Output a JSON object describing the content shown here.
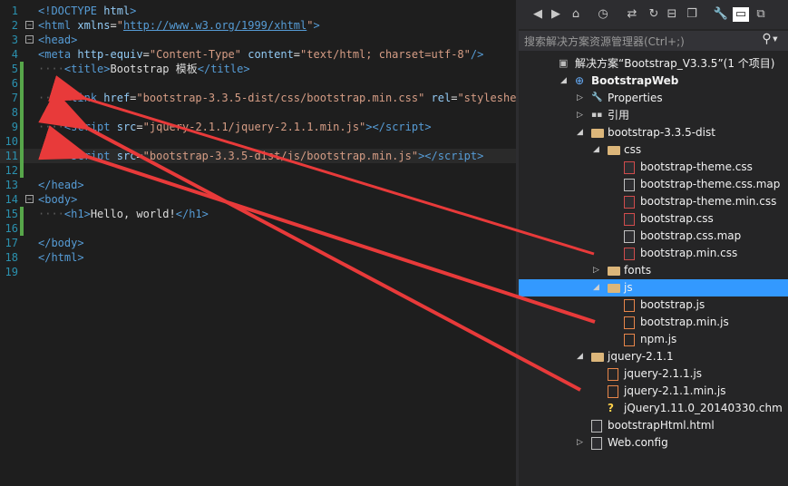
{
  "editor": {
    "lines": [
      {
        "n": "1",
        "html": [
          [
            "d",
            ""
          ],
          [
            "t",
            "<!DOCTYPE "
          ],
          [
            "a",
            "html"
          ],
          [
            "t",
            ">"
          ]
        ]
      },
      {
        "n": "2",
        "html": [
          [
            "t",
            "<"
          ],
          [
            "t",
            "html "
          ],
          [
            "a",
            "xmlns"
          ],
          [
            "x",
            "="
          ],
          [
            "s",
            "\""
          ],
          [
            "u",
            "http://www.w3.org/1999/xhtml"
          ],
          [
            "s",
            "\""
          ],
          [
            "t",
            ">"
          ]
        ]
      },
      {
        "n": "3",
        "html": [
          [
            "t",
            "<"
          ],
          [
            "t",
            "head"
          ],
          [
            "t",
            ">"
          ]
        ]
      },
      {
        "n": "4",
        "html": [
          [
            "t",
            "<"
          ],
          [
            "t",
            "meta "
          ],
          [
            "a",
            "http-equiv"
          ],
          [
            "x",
            "="
          ],
          [
            "s",
            "\"Content-Type\" "
          ],
          [
            "a",
            "content"
          ],
          [
            "x",
            "="
          ],
          [
            "s",
            "\"text/html; charset=utf-8\""
          ],
          [
            "t",
            "/>"
          ]
        ]
      },
      {
        "n": "5",
        "html": [
          [
            "d",
            "····"
          ],
          [
            "t",
            "<"
          ],
          [
            "t",
            "title"
          ],
          [
            "t",
            ">"
          ],
          [
            "x",
            "Bootstrap 模板"
          ],
          [
            "t",
            "</"
          ],
          [
            "t",
            "title"
          ],
          [
            "t",
            ">"
          ]
        ]
      },
      {
        "n": "6",
        "html": []
      },
      {
        "n": "7",
        "html": [
          [
            "d",
            "····"
          ],
          [
            "t",
            "<"
          ],
          [
            "t",
            "link "
          ],
          [
            "a",
            "href"
          ],
          [
            "x",
            "="
          ],
          [
            "s",
            "\"bootstrap-3.3.5-dist/css/bootstrap.min.css\" "
          ],
          [
            "a",
            "rel"
          ],
          [
            "x",
            "="
          ],
          [
            "s",
            "\"stylesheet\""
          ]
        ]
      },
      {
        "n": "8",
        "html": []
      },
      {
        "n": "9",
        "html": [
          [
            "d",
            "····"
          ],
          [
            "t",
            "<"
          ],
          [
            "t",
            "script "
          ],
          [
            "a",
            "src"
          ],
          [
            "x",
            "="
          ],
          [
            "s",
            "\"jquery-2.1.1/jquery-2.1.1.min.js\""
          ],
          [
            "t",
            "></"
          ],
          [
            "t",
            "script"
          ],
          [
            "t",
            ">"
          ]
        ]
      },
      {
        "n": "10",
        "html": []
      },
      {
        "n": "11",
        "html": [
          [
            "d",
            "····"
          ],
          [
            "t",
            "<"
          ],
          [
            "t",
            "script "
          ],
          [
            "a",
            "src"
          ],
          [
            "x",
            "="
          ],
          [
            "s",
            "\"bootstrap-3.3.5-dist/js/bootstrap.min.js\""
          ],
          [
            "t",
            "></"
          ],
          [
            "t",
            "script"
          ],
          [
            "t",
            ">"
          ]
        ]
      },
      {
        "n": "12",
        "html": []
      },
      {
        "n": "13",
        "html": [
          [
            "t",
            "</"
          ],
          [
            "t",
            "head"
          ],
          [
            "t",
            ">"
          ]
        ]
      },
      {
        "n": "14",
        "html": [
          [
            "t",
            "<"
          ],
          [
            "t",
            "body"
          ],
          [
            "t",
            ">"
          ]
        ]
      },
      {
        "n": "15",
        "html": [
          [
            "d",
            "····"
          ],
          [
            "t",
            "<"
          ],
          [
            "t",
            "h1"
          ],
          [
            "t",
            ">"
          ],
          [
            "x",
            "Hello, world!"
          ],
          [
            "t",
            "</"
          ],
          [
            "t",
            "h1"
          ],
          [
            "t",
            ">"
          ]
        ]
      },
      {
        "n": "16",
        "html": []
      },
      {
        "n": "17",
        "html": [
          [
            "t",
            "</"
          ],
          [
            "t",
            "body"
          ],
          [
            "t",
            ">"
          ]
        ]
      },
      {
        "n": "18",
        "html": [
          [
            "t",
            "</"
          ],
          [
            "t",
            "html"
          ],
          [
            "t",
            ">"
          ]
        ]
      },
      {
        "n": "19",
        "html": []
      }
    ]
  },
  "solution_explorer": {
    "search_placeholder": "搜索解决方案资源管理器(Ctrl+;)",
    "toolbar_icons": [
      "back-icon",
      "forward-icon",
      "home-icon",
      "history-icon",
      "sync-icon",
      "refresh-icon",
      "collapse-all-icon",
      "show-all-files-icon",
      "properties-icon",
      "preview-icon",
      "class-view-icon"
    ],
    "tree": [
      {
        "label": "解决方案“Bootstrap_V3.3.5”(1 个项目)",
        "indent": 0,
        "icon": "solution-icon",
        "tri": ""
      },
      {
        "label": "BootstrapWeb",
        "indent": 1,
        "icon": "web-project-icon",
        "tri": "open",
        "bold": true
      },
      {
        "label": "Properties",
        "indent": 2,
        "icon": "wrench-icon",
        "tri": "closed"
      },
      {
        "label": "引用",
        "indent": 2,
        "icon": "references-icon",
        "tri": "closed"
      },
      {
        "label": "bootstrap-3.3.5-dist",
        "indent": 2,
        "icon": "folder-icon",
        "tri": "open"
      },
      {
        "label": "css",
        "indent": 3,
        "icon": "folder-icon",
        "tri": "open"
      },
      {
        "label": "bootstrap-theme.css",
        "indent": 4,
        "icon": "css-file-icon",
        "tri": ""
      },
      {
        "label": "bootstrap-theme.css.map",
        "indent": 4,
        "icon": "file-icon",
        "tri": ""
      },
      {
        "label": "bootstrap-theme.min.css",
        "indent": 4,
        "icon": "css-file-icon",
        "tri": ""
      },
      {
        "label": "bootstrap.css",
        "indent": 4,
        "icon": "css-file-icon",
        "tri": ""
      },
      {
        "label": "bootstrap.css.map",
        "indent": 4,
        "icon": "file-icon",
        "tri": ""
      },
      {
        "label": "bootstrap.min.css",
        "indent": 4,
        "icon": "css-file-icon",
        "tri": ""
      },
      {
        "label": "fonts",
        "indent": 3,
        "icon": "folder-icon",
        "tri": "closed"
      },
      {
        "label": "js",
        "indent": 3,
        "icon": "folder-icon",
        "tri": "open",
        "selected": true
      },
      {
        "label": "bootstrap.js",
        "indent": 4,
        "icon": "js-file-icon",
        "tri": ""
      },
      {
        "label": "bootstrap.min.js",
        "indent": 4,
        "icon": "js-file-icon",
        "tri": ""
      },
      {
        "label": "npm.js",
        "indent": 4,
        "icon": "js-file-icon",
        "tri": ""
      },
      {
        "label": "jquery-2.1.1",
        "indent": 2,
        "icon": "folder-icon",
        "tri": "open"
      },
      {
        "label": "jquery-2.1.1.js",
        "indent": 3,
        "icon": "js-file-icon",
        "tri": ""
      },
      {
        "label": "jquery-2.1.1.min.js",
        "indent": 3,
        "icon": "js-file-icon",
        "tri": ""
      },
      {
        "label": "jQuery1.11.0_20140330.chm",
        "indent": 3,
        "icon": "help-file-icon",
        "tri": ""
      },
      {
        "label": "bootstrapHtml.html",
        "indent": 2,
        "icon": "html-file-icon",
        "tri": ""
      },
      {
        "label": "Web.config",
        "indent": 2,
        "icon": "config-file-icon",
        "tri": "closed"
      }
    ]
  },
  "annotation_color": "#e83a3a"
}
